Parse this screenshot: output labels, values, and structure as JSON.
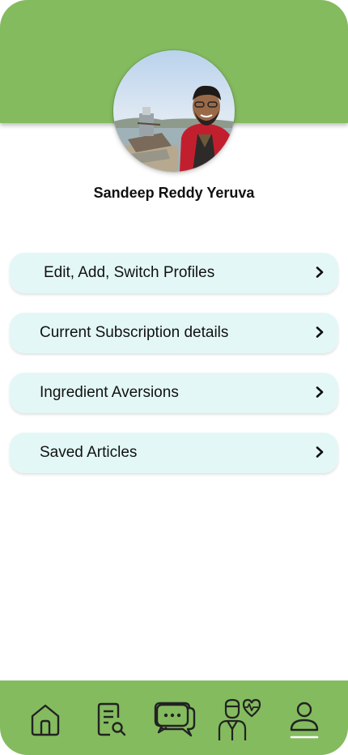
{
  "profile": {
    "name": "Sandeep Reddy Yeruva"
  },
  "menu": {
    "items": [
      {
        "label": "Edit, Add, Switch Profiles"
      },
      {
        "label": "Current Subscription details"
      },
      {
        "label": "Ingredient Aversions"
      },
      {
        "label": "Saved Articles"
      }
    ]
  },
  "nav": {
    "items": [
      {
        "icon": "home-icon"
      },
      {
        "icon": "document-search-icon"
      },
      {
        "icon": "chat-icon"
      },
      {
        "icon": "doctor-heart-icon"
      },
      {
        "icon": "profile-icon",
        "active": true
      }
    ]
  },
  "colors": {
    "brand_green": "#84bb5f",
    "menu_bg": "#e3f8f6",
    "text": "#111111"
  }
}
